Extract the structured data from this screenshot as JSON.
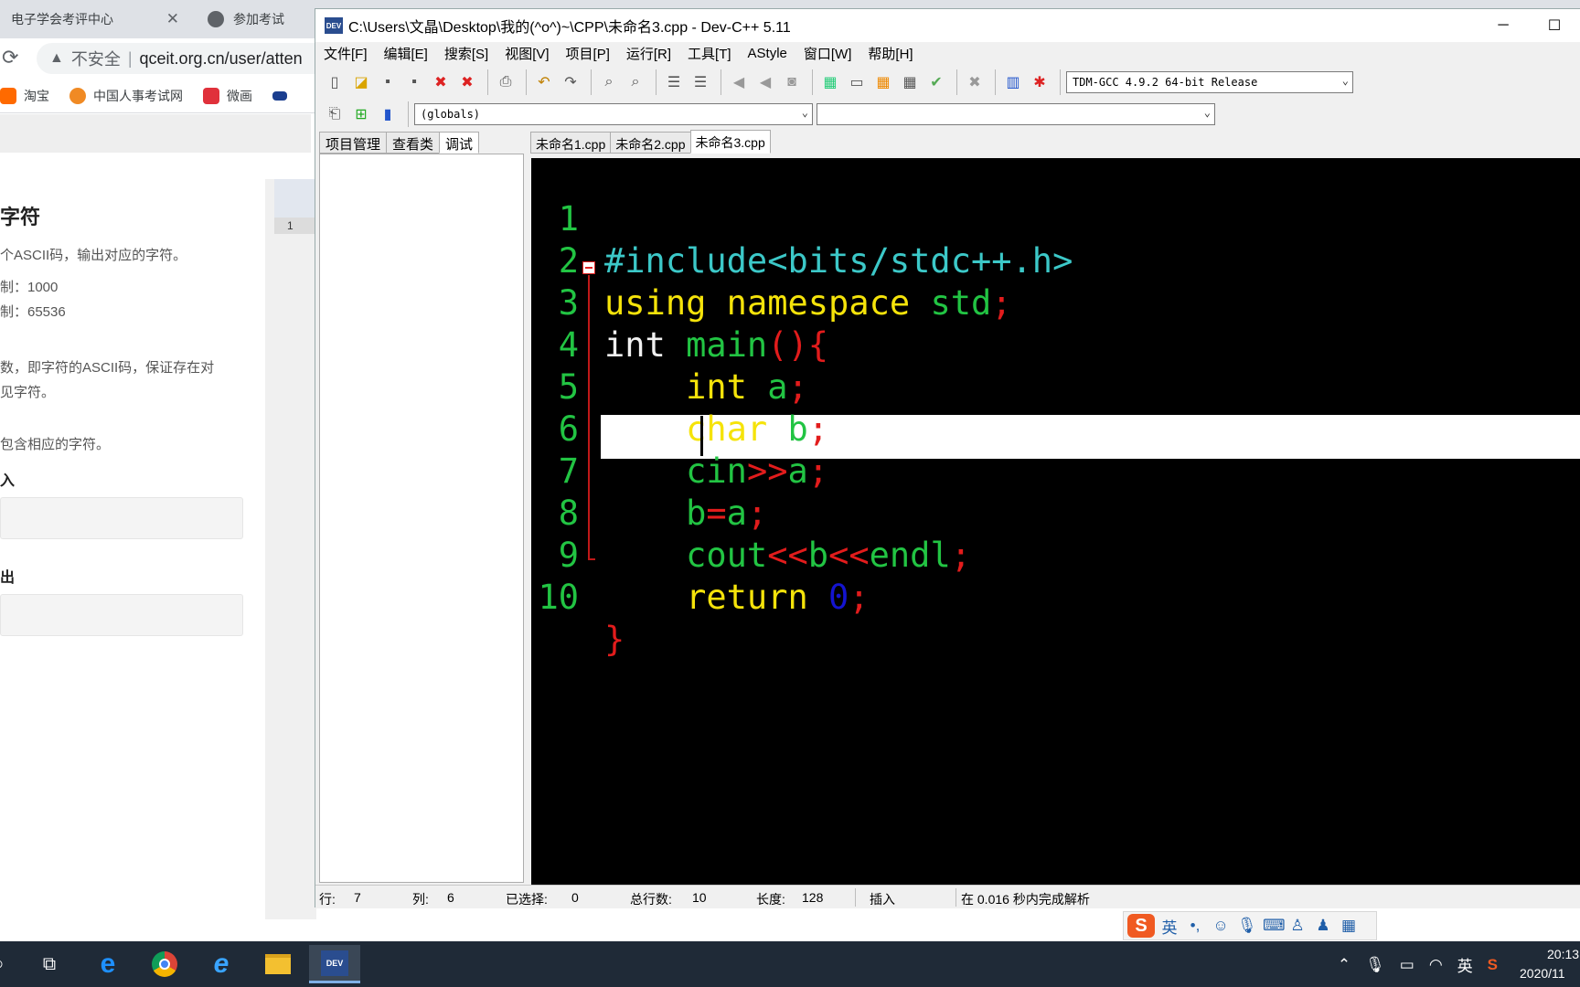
{
  "browser": {
    "tabs": [
      {
        "label": "电子学会考评中心",
        "close": "✕"
      },
      {
        "label": "参加考试"
      }
    ],
    "address": {
      "insecure": "不安全",
      "url": "qceit.org.cn/user/atten"
    },
    "bookmarks": [
      "淘宝",
      "中国人事考试网",
      "微画",
      ""
    ],
    "problem": {
      "title": "字符",
      "desc": "个ASCII码，输出对应的字符。",
      "time_limit": "制：1000",
      "mem_limit": "制：65536",
      "input_desc_1": "数，即字符的ASCII码，保证存在对",
      "input_desc_2": "见字符。",
      "output_desc": "包含相应的字符。",
      "sample_input_label": "入",
      "sample_output_label": "出"
    },
    "gutter_line": "1"
  },
  "devcpp": {
    "title": "C:\\Users\\文晶\\Desktop\\我的(^o^)~\\CPP\\未命名3.cpp - Dev-C++ 5.11",
    "appicon": "DEV",
    "window_buttons": [
      "─",
      "☐"
    ],
    "menus": [
      "文件[F]",
      "编辑[E]",
      "搜索[S]",
      "视图[V]",
      "项目[P]",
      "运行[R]",
      "工具[T]",
      "AStyle",
      "窗口[W]",
      "帮助[H]"
    ],
    "compiler": "TDM-GCC 4.9.2 64-bit Release",
    "scope": "(globals)",
    "scope2": "",
    "left_tabs": [
      "项目管理",
      "查看类",
      "调试"
    ],
    "file_tabs": [
      "未命名1.cpp",
      "未命名2.cpp",
      "未命名3.cpp"
    ],
    "code": {
      "l1": "#include<bits/stdc++.h>",
      "l2a": "using",
      "l2b": " namespace ",
      "l2c": "std",
      "l2d": ";",
      "l3a": "int",
      "l3b": " main",
      "l3c": "(){",
      "l4a": "    int",
      "l4b": " a",
      "l4c": ";",
      "l5a": "    char",
      "l5b": " b",
      "l5c": ";",
      "l6a": "    cin",
      "l6b": ">>",
      "l6c": "a",
      "l6d": ";",
      "l7a": "    b",
      "l7b": "=",
      "l7c": "a",
      "l7d": ";",
      "l8a": "    cout",
      "l8b": "<<",
      "l8c": "b",
      "l8d": "<<",
      "l8e": "endl",
      "l8f": ";",
      "l9a": "    return",
      "l9b": " 0",
      "l9c": ";",
      "l10": "}"
    },
    "line_numbers": [
      "1",
      "2",
      "3",
      "4",
      "5",
      "6",
      "7",
      "8",
      "9",
      "10"
    ],
    "status": {
      "row_label": "行:",
      "row": "7",
      "col_label": "列:",
      "col": "6",
      "sel_label": "已选择:",
      "sel": "0",
      "lines_label": "总行数:",
      "lines": "10",
      "len_label": "长度:",
      "len": "128",
      "mode": "插入",
      "parse": "在 0.016 秒内完成解析"
    }
  },
  "ime": {
    "logo": "S",
    "lang": "英",
    "punct": "•,",
    "icons": [
      "smile-icon",
      "mic-icon",
      "keyboard-icon",
      "user-icon",
      "shirt-icon",
      "grid-icon"
    ]
  },
  "taskbar": {
    "tray_lang": "英",
    "time": "20:13",
    "date": "2020/11"
  }
}
